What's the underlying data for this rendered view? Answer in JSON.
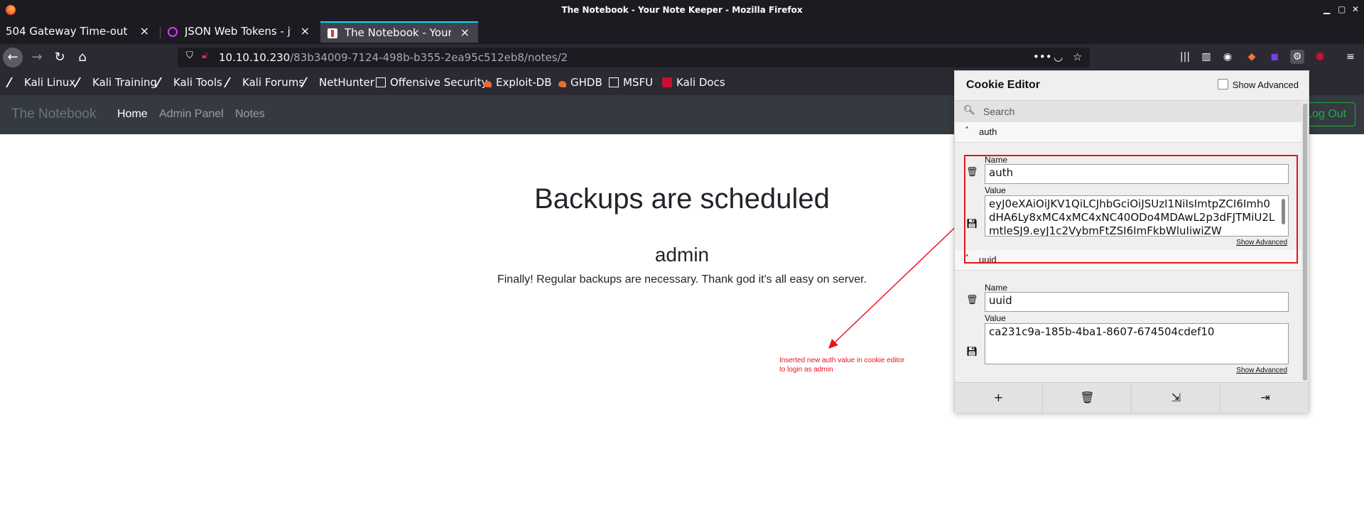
{
  "window": {
    "title": "The Notebook - Your Note Keeper - Mozilla Firefox"
  },
  "tabs": [
    {
      "label": "504 Gateway Time-out",
      "active": false
    },
    {
      "label": "JSON Web Tokens - jwt.i",
      "active": false
    },
    {
      "label": "The Notebook - Your Not",
      "active": true
    }
  ],
  "urlbar": {
    "host": "10.10.10.230",
    "path": "/83b34009-7124-498b-b355-2ea95c512eb8/notes/2"
  },
  "bookmarks": [
    {
      "label": "Kali Linux",
      "icon": "kali-dragon-icon"
    },
    {
      "label": "Kali Training",
      "icon": "kali-dragon-icon"
    },
    {
      "label": "Kali Tools",
      "icon": "kali-dragon-icon"
    },
    {
      "label": "Kali Forums",
      "icon": "kali-dragon-icon"
    },
    {
      "label": "NetHunter",
      "icon": "kali-dragon-icon"
    },
    {
      "label": "Offensive Security",
      "icon": "offsec-icon"
    },
    {
      "label": "Exploit-DB",
      "icon": "exploitdb-icon"
    },
    {
      "label": "GHDB",
      "icon": "exploitdb-icon"
    },
    {
      "label": "MSFU",
      "icon": "offsec-icon"
    },
    {
      "label": "Kali Docs",
      "icon": "kali-docs-icon"
    }
  ],
  "site": {
    "brand": "The Notebook",
    "nav": [
      "Home",
      "Admin Panel",
      "Notes"
    ],
    "logout": "Log Out"
  },
  "note": {
    "title": "Backups are scheduled",
    "author": "admin",
    "body": "Finally! Regular backups are necessary. Thank god it's all easy on server."
  },
  "cookie_editor": {
    "title": "Cookie Editor",
    "show_advanced": "Show Advanced",
    "search_placeholder": "Search",
    "name_label": "Name",
    "value_label": "Value",
    "show_advanced_link": "Show Advanced",
    "cookies": [
      {
        "name": "auth",
        "value": "eyJ0eXAiOiJKV1QiLCJhbGciOiJSUzI1NiIsImtpZCI6Imh0dHA6Ly8xMC4xMC4xNC40ODo4MDAwL2p3dFJTMiU2LmtleSJ9.eyJ1c2VybmFtZSI6ImFkbWluIiwiZW"
      },
      {
        "name": "uuid",
        "value": "ca231c9a-185b-4ba1-8607-674504cdef10"
      }
    ]
  },
  "annotation": {
    "text": "Inserted new auth value in cookie editor to login as admin",
    "color": "#e8141c"
  }
}
